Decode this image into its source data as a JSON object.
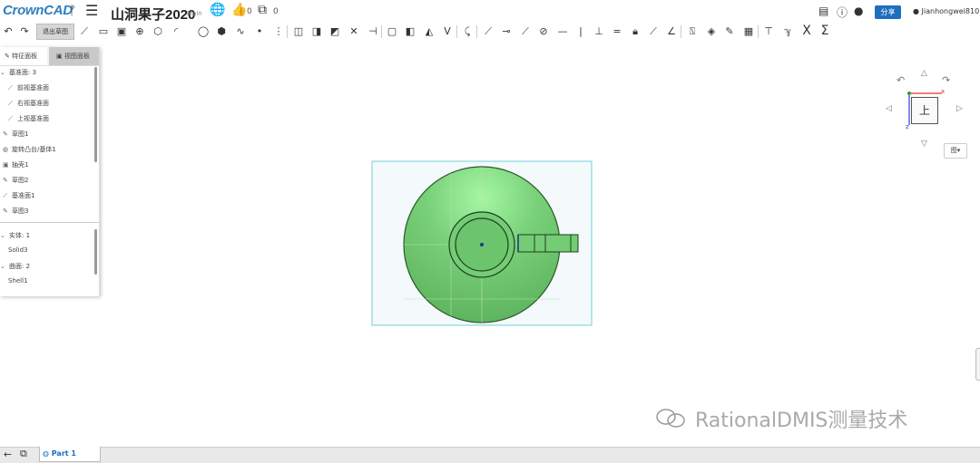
{
  "app": {
    "logo": "CrownCAD",
    "doc_title": "山洞果子2020",
    "branch": "Main",
    "likes": "0",
    "copies": "0"
  },
  "header": {
    "share_label": "分享",
    "user_name": "Jianhongwei810"
  },
  "toolbar": {
    "exit_sketch_label": "退出草图",
    "icons": [
      "undo-icon",
      "redo-icon",
      "line-icon",
      "rectangle-icon",
      "slot-icon",
      "circle-icon",
      "polygon-icon",
      "arc-icon",
      "ellipse-icon",
      "spline-icon",
      "point-icon",
      "centerline-icon",
      "offset-icon",
      "mirror-icon",
      "pattern-icon",
      "trim-icon",
      "extend-icon",
      "convert-icon",
      "text-icon",
      "project-icon",
      "split-icon",
      "fillet-icon",
      "chamfer-icon",
      "horizontal-icon",
      "vertical-icon",
      "coincident-icon",
      "parallel-icon",
      "perpendicular-icon",
      "equal-icon",
      "fix-icon",
      "tangent-icon",
      "dimension-icon",
      "measure-icon",
      "sketch-tools-icon"
    ],
    "extra_x": "X",
    "extra_sigma": "Σ"
  },
  "panel": {
    "tabs": [
      "特征面板",
      "视图面板"
    ],
    "tree": [
      {
        "label": "基准面: 3",
        "icon": "⌄",
        "indent": 0
      },
      {
        "label": "前视基准面",
        "icon": "⟋",
        "indent": 1
      },
      {
        "label": "右视基准面",
        "icon": "⟋",
        "indent": 1
      },
      {
        "label": "上视基准面",
        "icon": "⟋",
        "indent": 1
      },
      {
        "label": "草图1",
        "icon": "✎",
        "indent": 0
      },
      {
        "label": "旋转凸台/基体1",
        "icon": "◍",
        "indent": 0
      },
      {
        "label": "抽壳1",
        "icon": "▣",
        "indent": 0
      },
      {
        "label": "草图2",
        "icon": "✎",
        "indent": 0
      },
      {
        "label": "基准面1",
        "icon": "⟋",
        "indent": 0
      },
      {
        "label": "草图3",
        "icon": "✎",
        "indent": 0
      }
    ],
    "bodies": [
      {
        "label": "实体: 1",
        "indent": 0
      },
      {
        "label": "Solid3",
        "indent": 1
      },
      {
        "label": "曲面: 2",
        "indent": 0
      },
      {
        "label": "Shell1",
        "indent": 1
      }
    ]
  },
  "viewcube": {
    "face_label": "上",
    "view_button_label": "图▾"
  },
  "bottom": {
    "part_tab": "Part 1"
  },
  "watermark": "RationalDMIS测量技术",
  "colors": {
    "accent": "#1e6fbe",
    "model_green": "#6cc76c",
    "model_light": "#9ff09a",
    "selection_box": "#6fd0d8"
  }
}
